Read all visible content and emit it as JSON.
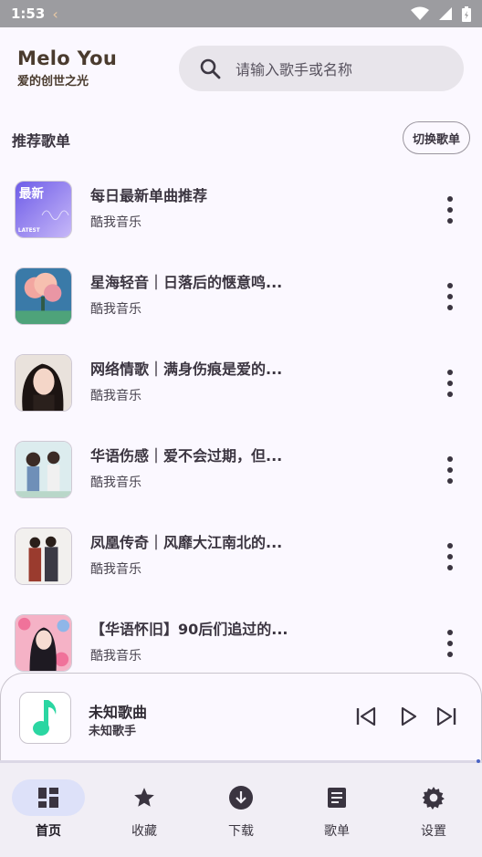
{
  "status_bar": {
    "time": "1:53"
  },
  "header": {
    "app_name": "Melo You",
    "slogan": "爱的创世之光",
    "search": {
      "placeholder": "请输入歌手或名称",
      "icon": "search-icon"
    }
  },
  "section": {
    "title": "推荐歌单",
    "switch_label": "切换歌单"
  },
  "playlists": [
    {
      "title": "每日最新单曲推荐",
      "author": "酷我音乐",
      "cover": "latest",
      "cover_text": "最新",
      "cover_subtext": "LATEST"
    },
    {
      "title": "星海轻音｜日落后的惬意鸣...",
      "author": "酷我音乐",
      "cover": "cloud-tree"
    },
    {
      "title": "网络情歌｜满身伤痕是爱的...",
      "author": "酷我音乐",
      "cover": "portrait"
    },
    {
      "title": "华语伤感｜爱不会过期，但...",
      "author": "酷我音乐",
      "cover": "couple-illustration"
    },
    {
      "title": "凤凰传奇｜风靡大江南北的...",
      "author": "酷我音乐",
      "cover": "duo-photo"
    },
    {
      "title": "【华语怀旧】90后们追过的...",
      "author": "酷我音乐",
      "cover": "flower-girl"
    }
  ],
  "player": {
    "song": "未知歌曲",
    "artist": "未知歌手",
    "icons": [
      "music-note-icon",
      "skip-previous-icon",
      "play-icon",
      "skip-next-icon"
    ],
    "accent": "#2bd6a2"
  },
  "bottom_nav": [
    {
      "label": "首页",
      "icon": "dashboard-icon",
      "active": true
    },
    {
      "label": "收藏",
      "icon": "star-icon",
      "active": false
    },
    {
      "label": "下载",
      "icon": "download-icon",
      "active": false
    },
    {
      "label": "歌单",
      "icon": "playlist-icon",
      "active": false
    },
    {
      "label": "设置",
      "icon": "gear-icon",
      "active": false
    }
  ]
}
